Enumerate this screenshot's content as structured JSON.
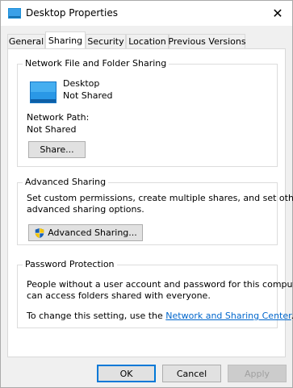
{
  "window": {
    "title": "Desktop Properties",
    "close_glyph": "✕"
  },
  "tabs": [
    {
      "label": "General",
      "active": false
    },
    {
      "label": "Sharing",
      "active": true
    },
    {
      "label": "Security",
      "active": false
    },
    {
      "label": "Location",
      "active": false
    },
    {
      "label": "Previous Versions",
      "active": false
    }
  ],
  "network_sharing": {
    "group_title": "Network File and Folder Sharing",
    "folder_name": "Desktop",
    "folder_status": "Not Shared",
    "path_label": "Network Path:",
    "path_value": "Not Shared",
    "share_button": "Share..."
  },
  "advanced_sharing": {
    "group_title": "Advanced Sharing",
    "description_line1": "Set custom permissions, create multiple shares, and set other",
    "description_line2": "advanced sharing options.",
    "button_label": "Advanced Sharing..."
  },
  "password_protection": {
    "group_title": "Password Protection",
    "description_line1": "People without a user account and password for this computer",
    "description_line2": "can access folders shared with everyone.",
    "change_prefix": "To change this setting, use the ",
    "link_text": "Network and Sharing Center",
    "change_suffix": "."
  },
  "footer": {
    "ok": "OK",
    "cancel": "Cancel",
    "apply": "Apply"
  },
  "icons": {
    "title": "folder-desktop-icon",
    "folder": "desktop-folder-icon",
    "shield": "uac-shield-icon"
  },
  "colors": {
    "accent": "#0078d7",
    "link": "#0066cc",
    "disabled_text": "#a0a0a0"
  }
}
